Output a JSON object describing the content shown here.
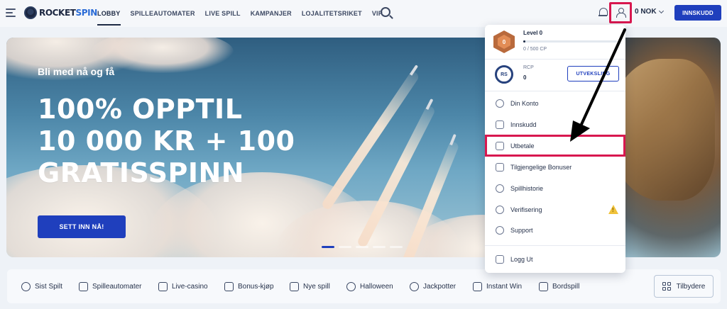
{
  "header": {
    "logo_part1": "ROCKET",
    "logo_part2": "SPIN",
    "nav": [
      "LOBBY",
      "SPILLEAUTOMATER",
      "LIVE SPILL",
      "KAMPANJER",
      "LOJALITETSRIKET",
      "VIP"
    ],
    "balance": "0 NOK",
    "deposit_label": "INNSKUDD"
  },
  "hero": {
    "subtitle": "Bli med nå og få",
    "title_line1": "100% OPPTIL",
    "title_line2": "10 000 KR + 100",
    "title_line3": "GRATISSPINN",
    "cta": "SETT INN NÅ!"
  },
  "dropdown": {
    "level_badge": "0",
    "level_title": "Level 0",
    "level_progress": 0.0,
    "level_cp": "0 / 500 CP",
    "rs_badge": "RS",
    "rcp_label": "RCP",
    "rcp_value": "0",
    "exchange_label": "UTVEKSLING",
    "items": [
      "Din Konto",
      "Innskudd",
      "Utbetale",
      "Tilgjengelige Bonuser",
      "Spillhistorie",
      "Verifisering",
      "Support"
    ],
    "logout": "Logg Ut"
  },
  "categories": [
    "Sist Spilt",
    "Spilleautomater",
    "Live-casino",
    "Bonus-kjøp",
    "Nye spill",
    "Halloween",
    "Jackpotter",
    "Instant Win",
    "Bordspill"
  ],
  "providers_label": "Tilbydere",
  "colors": {
    "brand_blue": "#1f3fbd",
    "highlight_red": "#d8174f"
  }
}
